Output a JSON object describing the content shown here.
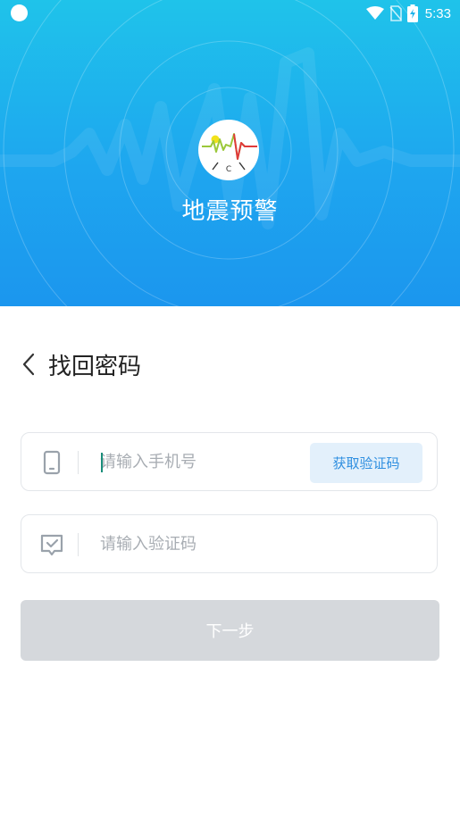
{
  "status_bar": {
    "time": "5:33",
    "icons": [
      "notification-dot-icon",
      "wifi-icon",
      "no-sim-icon",
      "battery-charging-icon"
    ]
  },
  "header": {
    "app_name": "地震预警",
    "logo_icon": "seismic-wave-logo-icon",
    "logo_text": "C",
    "gradient_top": "#1fc3ea",
    "gradient_bottom": "#1b96ee"
  },
  "page": {
    "title": "找回密码",
    "back_icon": "chevron-left-icon"
  },
  "phone": {
    "placeholder": "请输入手机号",
    "value": "",
    "icon": "phone-icon",
    "get_code_label": "获取验证码"
  },
  "verify": {
    "placeholder": "请输入验证码",
    "value": "",
    "icon": "message-check-icon"
  },
  "next_label": "下一步",
  "colors": {
    "accent": "#2f8fe0",
    "button_disabled": "#d5d8dc",
    "code_button_bg": "#e3f0fb"
  }
}
